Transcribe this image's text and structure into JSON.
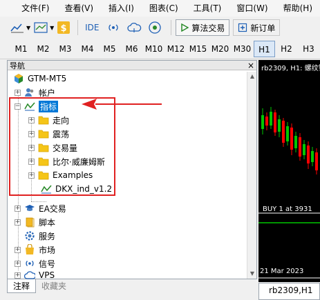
{
  "menubar": {
    "items": [
      "文件(F)",
      "查看(V)",
      "插入(I)",
      "图表(C)",
      "工具(T)",
      "窗口(W)",
      "帮助(H)"
    ]
  },
  "toolbar": {
    "ide_label": "IDE",
    "algo_trading_label": "算法交易",
    "new_order_label": "新订单"
  },
  "timeframes": {
    "items": [
      "M1",
      "M2",
      "M3",
      "M4",
      "M5",
      "M6",
      "M10",
      "M12",
      "M15",
      "M20",
      "M30",
      "H1",
      "H2",
      "H3"
    ],
    "active": "H1"
  },
  "navigator": {
    "title": "导航",
    "close": "×",
    "root": "GTM-MT5",
    "accounts": "帐户",
    "indicators": "指标",
    "indicator_folders": [
      "走向",
      "震荡",
      "交易量",
      "比尔·威廉姆斯",
      "Examples"
    ],
    "indicator_file": "DKX_ind_v1.2",
    "ea": "EA交易",
    "scripts": "脚本",
    "services": "服务",
    "market": "市场",
    "signals": "信号",
    "vps": "VPS"
  },
  "bottom_tabs": {
    "active": "注释",
    "inactive": "收藏夹"
  },
  "chart": {
    "title": "rb2309, H1:  螺纹钢",
    "buy_label": "BUY 1 at 3931",
    "date_label": "21 Mar 2023",
    "tab_label": "rb2309,H1"
  },
  "colors": {
    "accent": "#0078d7",
    "highlight": "#e02020",
    "bull": "#00c800",
    "bear": "#ff0000"
  }
}
